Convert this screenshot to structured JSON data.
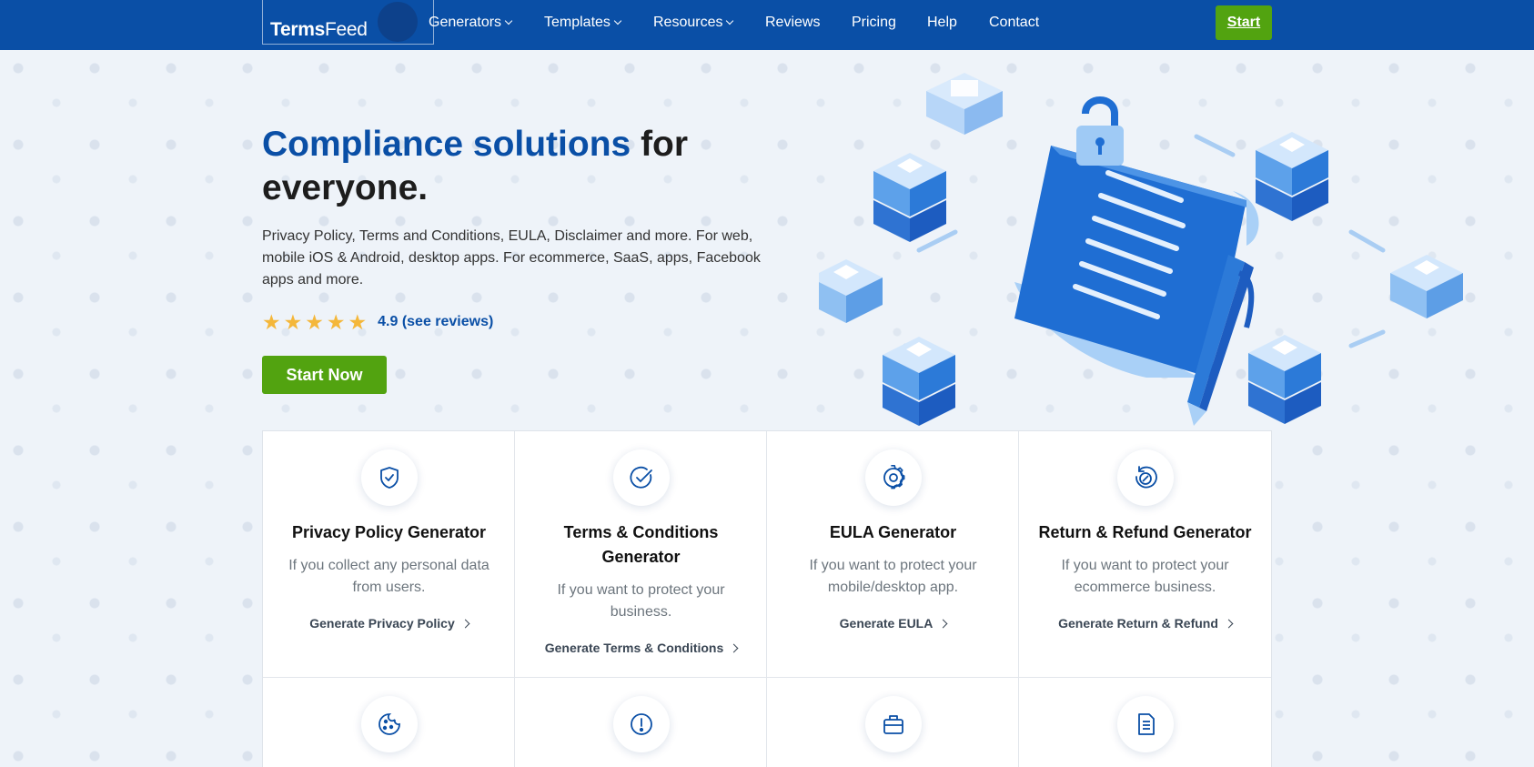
{
  "brand": {
    "name_bold": "Terms",
    "name_light": "Feed"
  },
  "nav": {
    "items": [
      {
        "label": "Generators",
        "dropdown": true
      },
      {
        "label": "Templates",
        "dropdown": true
      },
      {
        "label": "Resources",
        "dropdown": true
      },
      {
        "label": "Reviews",
        "dropdown": false
      },
      {
        "label": "Pricing",
        "dropdown": false
      },
      {
        "label": "Help",
        "dropdown": false
      },
      {
        "label": "Contact",
        "dropdown": false
      }
    ],
    "start_label": "Start"
  },
  "hero": {
    "title_accent": "Compliance solutions",
    "title_rest": "for everyone.",
    "description": "Privacy Policy, Terms and Conditions, EULA, Disclaimer and more. For web, mobile iOS & Android, desktop apps. For ecommerce, SaaS, apps, Facebook apps and more.",
    "rating_value": 4.9,
    "rating_text": "4.9 (see reviews)",
    "stars": 5,
    "cta_label": "Start Now"
  },
  "cards": [
    {
      "icon": "shield-check-icon",
      "title": "Privacy Policy Generator",
      "description": "If you collect any personal data from users.",
      "link": "Generate Privacy Policy"
    },
    {
      "icon": "check-circle-icon",
      "title": "Terms & Conditions Generator",
      "description": "If you want to protect your business.",
      "link": "Generate Terms & Conditions"
    },
    {
      "icon": "gear-icon",
      "title": "EULA Generator",
      "description": "If you want to protect your mobile/desktop app.",
      "link": "Generate EULA"
    },
    {
      "icon": "refund-icon",
      "title": "Return & Refund Generator",
      "description": "If you want to protect your ecommerce business.",
      "link": "Generate Return & Refund"
    },
    {
      "icon": "cookie-icon"
    },
    {
      "icon": "exclamation-circle-icon"
    },
    {
      "icon": "briefcase-icon"
    },
    {
      "icon": "document-icon"
    }
  ],
  "colors": {
    "primary": "#0a4fa6",
    "cta_green": "#52a310",
    "star": "#f4b73a",
    "muted_text": "#6c757d"
  }
}
